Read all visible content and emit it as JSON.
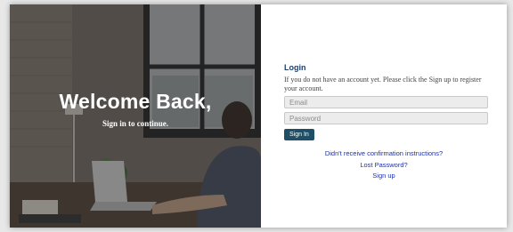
{
  "hero": {
    "title": "Welcome Back,",
    "subtitle": "Sign in to continue."
  },
  "login": {
    "title": "Login",
    "description": "If you do not have an account yet. Please click the Sign up to register your account.",
    "email_placeholder": "Email",
    "password_placeholder": "Password",
    "signin_label": "Sign In"
  },
  "links": {
    "confirmation": "Didn't receive confirmation instructions?",
    "lost_password": "Lost Password?",
    "signup": "Sign up"
  },
  "colors": {
    "button": "#1e4f66",
    "title": "#1f3f6e",
    "link": "#1a2fb0"
  }
}
